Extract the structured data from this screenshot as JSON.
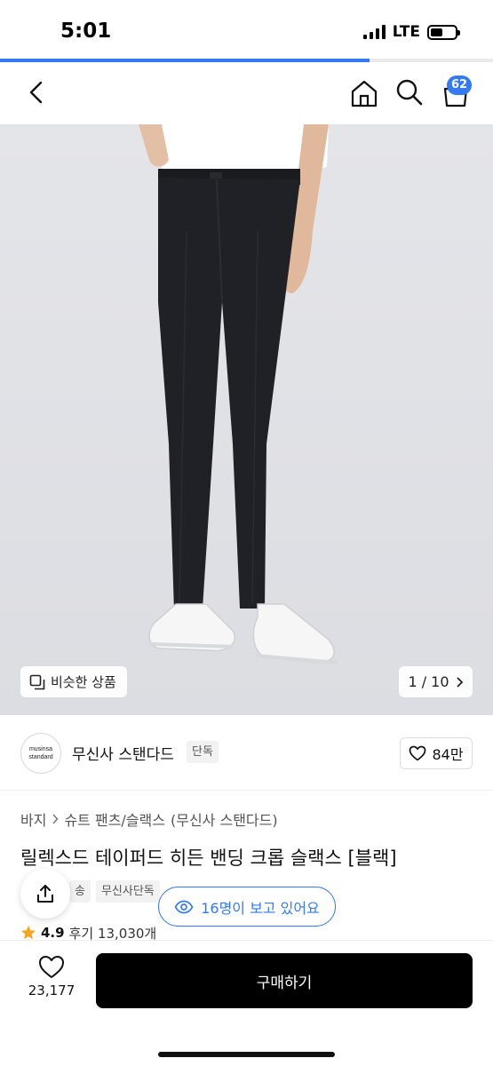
{
  "status_bar": {
    "time": "5:01",
    "network": "LTE"
  },
  "page_load_progress": 0.75,
  "nav": {
    "cart_count": "62"
  },
  "hero": {
    "similar_label": "비슷한 상품",
    "pager": "1 / 10"
  },
  "brand": {
    "logo_line1": "musinsa",
    "logo_line2": "standard",
    "name": "무신사 스탠다드",
    "tag": "단독",
    "likes": "84만"
  },
  "breadcrumb": [
    "바지",
    "슈트 팬츠/슬랙스",
    "(무신사 스탠다드)"
  ],
  "product": {
    "title": "릴렉스드 테이퍼드 히든 밴딩 크롭 슬랙스 [블랙]",
    "tags": [
      "송",
      "무신사단독"
    ],
    "rating": "4.9",
    "reviews": "후기 13,030개",
    "viewers": "16명이 보고 있어요"
  },
  "bottom": {
    "wish_count": "23,177",
    "buy_label": "구매하기"
  },
  "colors": {
    "accent": "#3479f6",
    "buy_button": "#000000",
    "star": "#f5a623"
  }
}
